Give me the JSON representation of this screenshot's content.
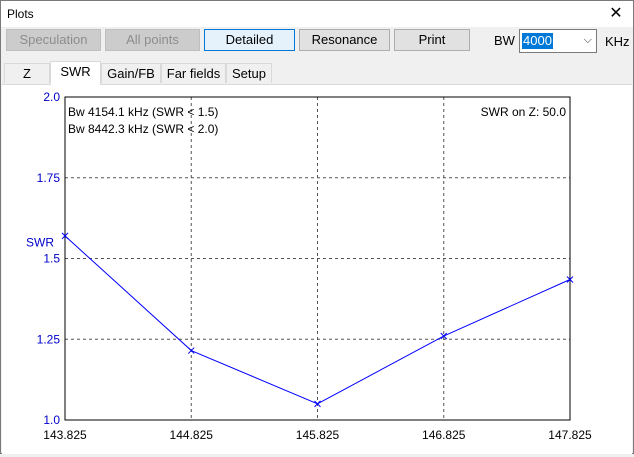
{
  "window": {
    "title": "Plots",
    "close_glyph": "✕"
  },
  "toolbar": {
    "buttons": [
      {
        "label": "Speculation",
        "state": "disabled"
      },
      {
        "label": "All points",
        "state": "disabled"
      },
      {
        "label": "Detailed",
        "state": "active"
      },
      {
        "label": "Resonance",
        "state": "normal"
      },
      {
        "label": "Print",
        "state": "normal"
      }
    ],
    "bw_label": "BW",
    "bw_value": "4000",
    "bw_unit": "KHz"
  },
  "tabs": [
    {
      "label": "Z",
      "selected": false
    },
    {
      "label": "SWR",
      "selected": true
    },
    {
      "label": "Gain/FB",
      "selected": false
    },
    {
      "label": "Far fields",
      "selected": false
    },
    {
      "label": "Setup",
      "selected": false
    }
  ],
  "chart_data": {
    "type": "line",
    "ylabel": "SWR",
    "xlabel": "",
    "xlim": [
      143.825,
      147.825
    ],
    "ylim": [
      1.0,
      2.0
    ],
    "x_ticks": [
      "143.825",
      "144.825",
      "145.825",
      "146.825",
      "147.825"
    ],
    "y_ticks": [
      "1.0",
      "1.25",
      "1.5",
      "1.75",
      "2.0"
    ],
    "grid": true,
    "series": [
      {
        "x": [
          143.825,
          144.825,
          145.825,
          146.825,
          147.825
        ],
        "y": [
          1.57,
          1.215,
          1.05,
          1.26,
          1.435
        ],
        "color": "#0000ff"
      }
    ],
    "annotations": [
      "Bw 4154.1 kHz (SWR < 1.5)",
      "Bw 8442.3 kHz (SWR < 2.0)",
      "SWR on Z: 50.0"
    ],
    "colors": {
      "axis_text": "#0000cc",
      "line": "#0000ff"
    }
  }
}
